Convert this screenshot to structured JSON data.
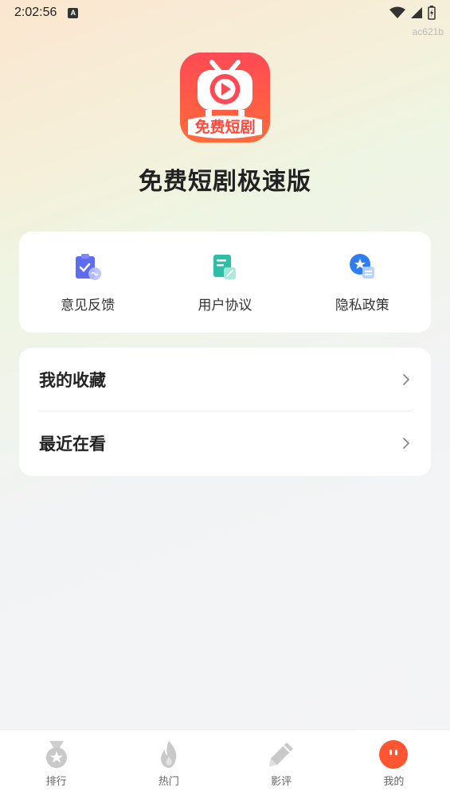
{
  "status_bar": {
    "time": "2:02:56",
    "notification_icon_letter": "A",
    "icons": [
      "wifi-icon",
      "signal-icon",
      "battery-charging-icon"
    ]
  },
  "version_code": "ac621b",
  "app": {
    "logo_text": "免费短剧",
    "name": "免费短剧极速版",
    "brand_colors": {
      "primary": "#fe4b48",
      "secondary": "#ff7a3c"
    }
  },
  "quick_actions": [
    {
      "label": "意见反馈",
      "icon": "feedback-clipboard-icon",
      "color": "#5d6cf2"
    },
    {
      "label": "用户协议",
      "icon": "agreement-doc-icon",
      "color": "#2ebfa9"
    },
    {
      "label": "隐私政策",
      "icon": "privacy-badge-icon",
      "color": "#2e7df5"
    }
  ],
  "menu": [
    {
      "label": "我的收藏",
      "icon": "chevron-right-icon"
    },
    {
      "label": "最近在看",
      "icon": "chevron-right-icon"
    }
  ],
  "tabs": [
    {
      "label": "排行",
      "icon": "medal-icon",
      "active": false
    },
    {
      "label": "热门",
      "icon": "flame-icon",
      "active": false
    },
    {
      "label": "影评",
      "icon": "pencil-icon",
      "active": false
    },
    {
      "label": "我的",
      "icon": "profile-face-icon",
      "active": true
    }
  ],
  "colors": {
    "tab_inactive": "#c9c9c9",
    "tab_active": "#ff5530"
  }
}
